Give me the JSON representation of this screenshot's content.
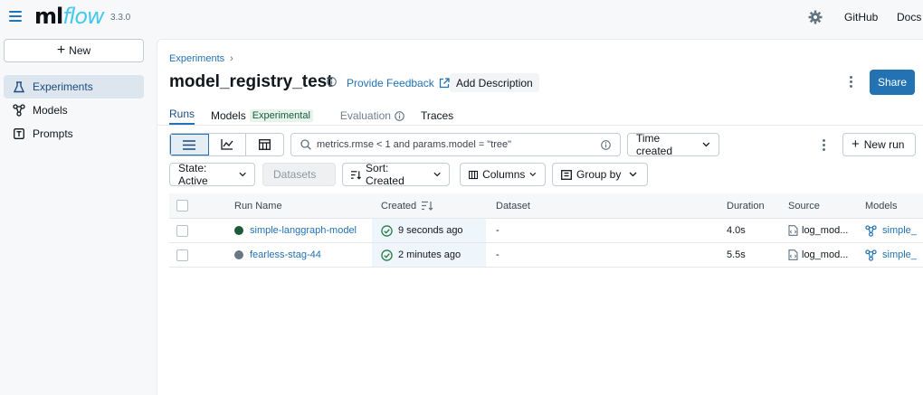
{
  "app": {
    "logo_ml": "ml",
    "logo_flow": "flow",
    "version": "3.3.0"
  },
  "topnav": {
    "github": "GitHub",
    "docs": "Docs"
  },
  "sidebar": {
    "new_label": "New",
    "items": [
      {
        "label": "Experiments",
        "icon": "beaker-icon"
      },
      {
        "label": "Models",
        "icon": "models-icon"
      },
      {
        "label": "Prompts",
        "icon": "prompt-icon"
      }
    ]
  },
  "breadcrumb": {
    "parent": "Experiments",
    "sep": "›"
  },
  "experiment": {
    "title": "model_registry_test",
    "feedback": "Provide Feedback",
    "add_description": "Add Description",
    "share": "Share"
  },
  "tabs": [
    {
      "label": "Runs"
    },
    {
      "label": "Models",
      "tag": "Experimental"
    },
    {
      "label": "Evaluation"
    },
    {
      "label": "Traces"
    }
  ],
  "search": {
    "value": "metrics.rmse < 1 and params.model = \"tree\""
  },
  "toolbar": {
    "time_created": "Time created",
    "new_run": "New run",
    "state": "State: Active",
    "datasets": "Datasets",
    "sort": "Sort: Created",
    "columns": "Columns",
    "group_by": "Group by"
  },
  "table": {
    "headers": [
      "Run Name",
      "Created",
      "Dataset",
      "Duration",
      "Source",
      "Models"
    ],
    "rows": [
      {
        "name": "simple-langgraph-model",
        "color": "#1e5a3a",
        "created": "9 seconds ago",
        "dataset": "-",
        "duration": "4.0s",
        "source": "log_mod...",
        "model": "simple_"
      },
      {
        "name": "fearless-stag-44",
        "color": "#6a7684",
        "created": "2 minutes ago",
        "dataset": "-",
        "duration": "5.5s",
        "source": "log_mod...",
        "model": "simple_"
      }
    ]
  }
}
